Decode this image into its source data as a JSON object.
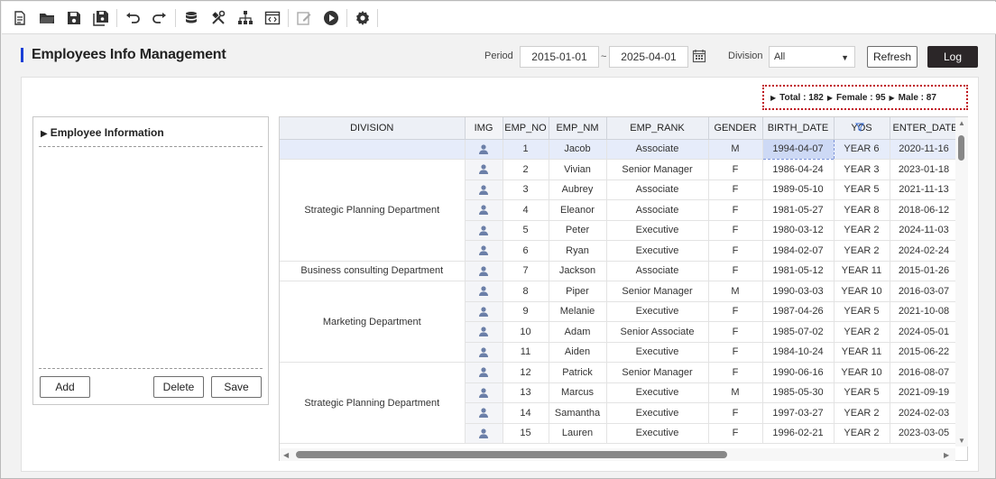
{
  "header": {
    "title": "Employees Info Management",
    "period_label": "Period",
    "date_from": "2015-01-01",
    "date_sep": "~",
    "date_to": "2025-04-01",
    "division_label": "Division",
    "division_value": "All",
    "refresh_label": "Refresh",
    "log_label": "Log"
  },
  "summary": {
    "total": "Total : 182",
    "female": "Female : 95",
    "male": "Male : 87"
  },
  "left_panel": {
    "title": "Employee Information",
    "add_label": "Add",
    "delete_label": "Delete",
    "save_label": "Save"
  },
  "grid": {
    "columns": [
      "DIVISION",
      "IMG",
      "EMP_NO",
      "EMP_NM",
      "EMP_RANK",
      "GENDER",
      "BIRTH_DATE",
      "YOS",
      "ENTER_DATE"
    ],
    "divisions": [
      "",
      "Strategic Planning Department",
      "Business consulting Department",
      "Marketing Department",
      "Strategic Planning Department"
    ],
    "rows": [
      {
        "emp_no": "1",
        "emp_nm": "Jacob",
        "rank": "Associate",
        "gender": "M",
        "birth": "1994-04-07",
        "yos": "YEAR 6",
        "enter": "2020-11-16"
      },
      {
        "emp_no": "2",
        "emp_nm": "Vivian",
        "rank": "Senior Manager",
        "gender": "F",
        "birth": "1986-04-24",
        "yos": "YEAR 3",
        "enter": "2023-01-18"
      },
      {
        "emp_no": "3",
        "emp_nm": "Aubrey",
        "rank": "Associate",
        "gender": "F",
        "birth": "1989-05-10",
        "yos": "YEAR 5",
        "enter": "2021-11-13"
      },
      {
        "emp_no": "4",
        "emp_nm": "Eleanor",
        "rank": "Associate",
        "gender": "F",
        "birth": "1981-05-27",
        "yos": "YEAR 8",
        "enter": "2018-06-12"
      },
      {
        "emp_no": "5",
        "emp_nm": "Peter",
        "rank": "Executive",
        "gender": "F",
        "birth": "1980-03-12",
        "yos": "YEAR 2",
        "enter": "2024-11-03"
      },
      {
        "emp_no": "6",
        "emp_nm": "Ryan",
        "rank": "Executive",
        "gender": "F",
        "birth": "1984-02-07",
        "yos": "YEAR 2",
        "enter": "2024-02-24"
      },
      {
        "emp_no": "7",
        "emp_nm": "Jackson",
        "rank": "Associate",
        "gender": "F",
        "birth": "1981-05-12",
        "yos": "YEAR 11",
        "enter": "2015-01-26"
      },
      {
        "emp_no": "8",
        "emp_nm": "Piper",
        "rank": "Senior Manager",
        "gender": "M",
        "birth": "1990-03-03",
        "yos": "YEAR 10",
        "enter": "2016-03-07"
      },
      {
        "emp_no": "9",
        "emp_nm": "Melanie",
        "rank": "Executive",
        "gender": "F",
        "birth": "1987-04-26",
        "yos": "YEAR 5",
        "enter": "2021-10-08"
      },
      {
        "emp_no": "10",
        "emp_nm": "Adam",
        "rank": "Senior Associate",
        "gender": "F",
        "birth": "1985-07-02",
        "yos": "YEAR 2",
        "enter": "2024-05-01"
      },
      {
        "emp_no": "11",
        "emp_nm": "Aiden",
        "rank": "Executive",
        "gender": "F",
        "birth": "1984-10-24",
        "yos": "YEAR 11",
        "enter": "2015-06-22"
      },
      {
        "emp_no": "12",
        "emp_nm": "Patrick",
        "rank": "Senior Manager",
        "gender": "F",
        "birth": "1990-06-16",
        "yos": "YEAR 10",
        "enter": "2016-08-07"
      },
      {
        "emp_no": "13",
        "emp_nm": "Marcus",
        "rank": "Executive",
        "gender": "M",
        "birth": "1985-05-30",
        "yos": "YEAR 5",
        "enter": "2021-09-19"
      },
      {
        "emp_no": "14",
        "emp_nm": "Samantha",
        "rank": "Executive",
        "gender": "F",
        "birth": "1997-03-27",
        "yos": "YEAR 2",
        "enter": "2024-02-03"
      },
      {
        "emp_no": "15",
        "emp_nm": "Lauren",
        "rank": "Executive",
        "gender": "F",
        "birth": "1996-02-21",
        "yos": "YEAR 2",
        "enter": "2023-03-05"
      }
    ]
  },
  "colors": {
    "accent": "#1a3fd6",
    "summary_border": "#c0141e",
    "log_button": "#2b2628",
    "header_bg": "#edf0f6",
    "selected_row": "#e6ecfa",
    "person_icon": "#6b7fa8"
  },
  "icons": {
    "toolbar": [
      "new-document-icon",
      "open-folder-icon",
      "save-icon",
      "save-all-icon",
      "undo-icon",
      "redo-icon",
      "database-icon",
      "tools-icon",
      "hierarchy-icon",
      "code-window-icon",
      "edit-icon",
      "play-icon",
      "gear-icon"
    ]
  }
}
